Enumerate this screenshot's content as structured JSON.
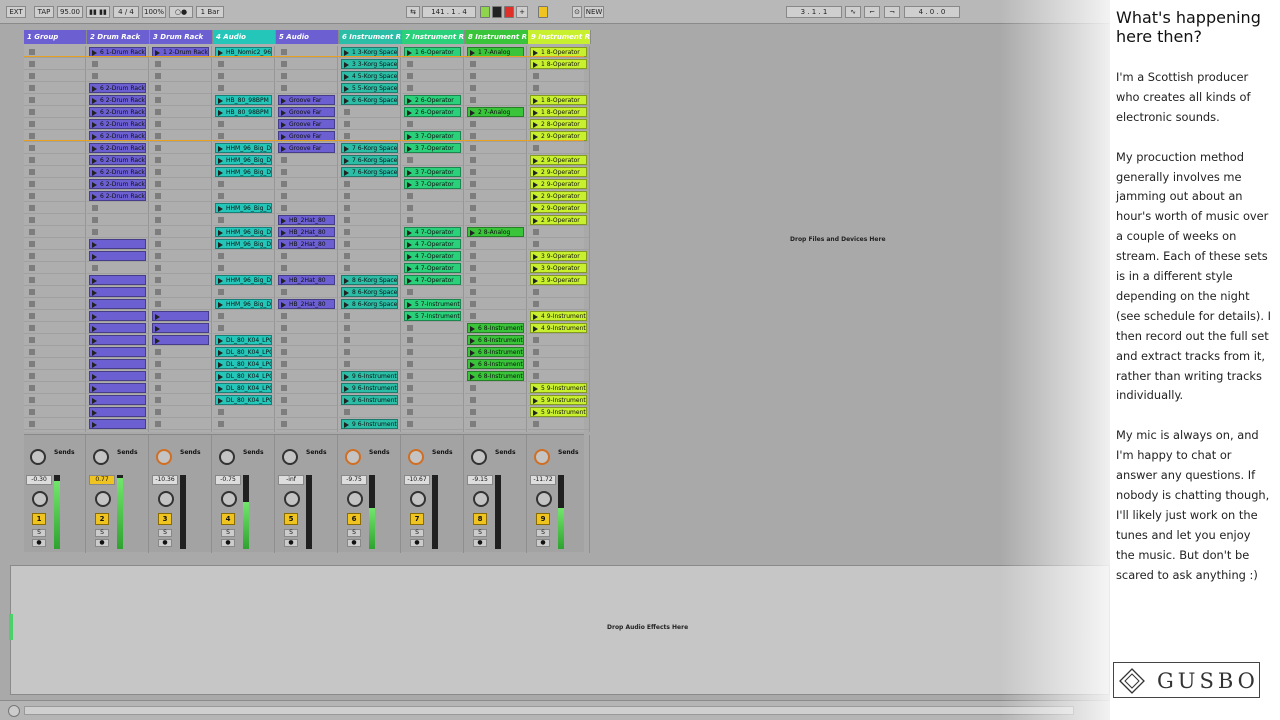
{
  "window": {
    "title": "Ableton Live Session View"
  },
  "toolbar": {
    "ext": "EXT",
    "tap": "TAP",
    "tempo": "95.00",
    "sig": "4 / 4",
    "zoom": "100%",
    "quant": "1 Bar",
    "pos": "141 . 1 . 4",
    "new": "NEW",
    "loop_start": "3 . 1 . 1",
    "loop_len": "4 . 0 . 0"
  },
  "tracks": [
    {
      "name": "1 Group",
      "color": "#6b5fd1",
      "clips": {}
    },
    {
      "name": "2 Drum Rack",
      "color": "#6b5fd1",
      "clips": {
        "0": "6 1-Drum Rack",
        "3": "6 2-Drum Rack",
        "4": "6 2-Drum Rack",
        "5": "6 2-Drum Rack",
        "6": "6 2-Drum Rack",
        "7": "6 2-Drum Rack",
        "8": "6 2-Drum Rack",
        "9": "6 2-Drum Rack",
        "10": "6 2-Drum Rack",
        "11": "6 2-Drum Rack",
        "12": "6 2-Drum Rack",
        "16": "",
        "17": "",
        "19": "",
        "20": "",
        "21": "",
        "22": "",
        "23": "",
        "24": "",
        "25": "",
        "26": "",
        "27": "",
        "28": "",
        "29": "",
        "30": "",
        "31": ""
      }
    },
    {
      "name": "3 Drum Rack",
      "color": "#6b5fd1",
      "clips": {
        "0": "1 2-Drum Rack",
        "22": "",
        "23": "",
        "24": ""
      }
    },
    {
      "name": "4 Audio",
      "color": "#23c6b8",
      "clips": {
        "0": "HB_Nomic2_96",
        "4": "HB_80_98BPM",
        "5": "HB_80_98BPM",
        "8": "HHM_96_Big_Di",
        "9": "HHM_96_Big_Di",
        "10": "HHM_96_Big_Di",
        "13": "HHM_96_Big_Di",
        "15": "HHM_96_Big_Di",
        "16": "HHM_96_Big_Di",
        "19": "HHM_96_Big_Di",
        "21": "HHM_96_Big_Di",
        "24": "DL_80_K04_LPG",
        "25": "DL_80_K04_LPG",
        "26": "DL_80_K04_LPG",
        "27": "DL_80_K04_LPG",
        "28": "DL_80_K04_LPG",
        "29": "DL_80_K04_LPG"
      }
    },
    {
      "name": "5 Audio",
      "color": "#6b5fd1",
      "clips": {
        "4": "Groove Far",
        "5": "Groove Far",
        "6": "Groove Far",
        "7": "Groove Far",
        "8": "Groove Far",
        "14": "HB_2Hat_80",
        "15": "HB_2Hat_80",
        "16": "HB_2Hat_80",
        "19": "HB_2Hat_80",
        "21": "HB_2Hat_80"
      }
    },
    {
      "name": "6 Instrument Ra",
      "color": "#2bbda6",
      "clips": {
        "0": "1 3-Korg Space",
        "1": "3 3-Korg Space",
        "2": "4 5-Korg Space",
        "3": "5 5-Korg Space",
        "4": "6 6-Korg Space",
        "8": "7 6-Korg Space",
        "9": "7 6-Korg Space",
        "10": "7 6-Korg Space",
        "19": "8 6-Korg Space",
        "20": "8 6-Korg Space",
        "21": "8 6-Korg Space",
        "27": "9 6-Instrument R",
        "28": "9 6-Instrument R",
        "29": "9 6-Instrument R",
        "31": "9 6-Instrument R"
      }
    },
    {
      "name": "7 Instrument Ra",
      "color": "#2ad07a",
      "clips": {
        "0": "1 6-Operator",
        "4": "2 6-Operator",
        "5": "2 6-Operator",
        "7": "3 7-Operator",
        "8": "3 7-Operator",
        "10": "3 7-Operator",
        "11": "3 7-Operator",
        "15": "4 7-Operator",
        "16": "4 7-Operator",
        "17": "4 7-Operator",
        "18": "4 7-Operator",
        "19": "4 7-Operator",
        "21": "5 7-Instrument R",
        "22": "5 7-Instrument R"
      }
    },
    {
      "name": "8 Instrument Ra",
      "color": "#39c43a",
      "clips": {
        "0": "1 7-Analog",
        "5": "2 7-Analog",
        "15": "2 8-Analog",
        "23": "6 8-Instrument R",
        "24": "6 8-Instrument R",
        "25": "6 8-Instrument R",
        "26": "6 8-Instrument R",
        "27": "6 8-Instrument R"
      }
    },
    {
      "name": "9 Instrument Ra",
      "color": "#c9f02e",
      "clips": {
        "0": "1 8-Operator",
        "1": "1 8-Operator",
        "4": "1 8-Operator",
        "5": "1 8-Operator",
        "6": "2 8-Operator",
        "7": "2 9-Operator",
        "9": "2 9-Operator",
        "10": "2 9-Operator",
        "11": "2 9-Operator",
        "12": "2 9-Operator",
        "13": "2 9-Operator",
        "14": "2 9-Operator",
        "17": "3 9-Operator",
        "18": "3 9-Operator",
        "19": "3 9-Operator",
        "22": "4 9-Instrument R",
        "23": "4 9-Instrument R",
        "28": "5 9-Instrument R",
        "29": "5 9-Instrument R",
        "30": "5 9-Instrument R"
      }
    }
  ],
  "mixer": [
    {
      "num": "1",
      "vol": "-0.30",
      "meter": 0.92,
      "orange": false
    },
    {
      "num": "2",
      "vol": "0.77",
      "meter": 0.96,
      "orange": false
    },
    {
      "num": "3",
      "vol": "-10.36",
      "meter": 0.0,
      "orange": true
    },
    {
      "num": "4",
      "vol": "-0.75",
      "meter": 0.63,
      "orange": false
    },
    {
      "num": "5",
      "vol": "-inf",
      "meter": 0.0,
      "orange": false
    },
    {
      "num": "6",
      "vol": "-9.75",
      "meter": 0.55,
      "orange": true
    },
    {
      "num": "7",
      "vol": "-10.67",
      "meter": 0.0,
      "orange": true
    },
    {
      "num": "8",
      "vol": "-9.15",
      "meter": 0.0,
      "orange": false
    },
    {
      "num": "9",
      "vol": "-11.72",
      "meter": 0.55,
      "orange": true
    }
  ],
  "sends_label": "Sends",
  "drop_files": "Drop Files and Devices Here",
  "drop_effects": "Drop Audio Effects Here",
  "panel": {
    "title": "What's happening here then?",
    "paragraphs": [
      "I'm a Scottish producer who creates all kinds of electronic sounds.",
      "My procuction method generally involves me jamming out about an hour's worth of music over a couple of weeks on stream.  Each of these sets is in a different style depending on the night (see schedule for details). I then record out the full set and extract tracks from it, rather than writing tracks individually.",
      "My mic is always on, and I'm happy to chat or answer any questions.  If nobody is chatting though, I'll likely just work on the tunes and let you enjoy the music. But don't be scared to ask anything :)"
    ],
    "logo": "GUSBO"
  }
}
